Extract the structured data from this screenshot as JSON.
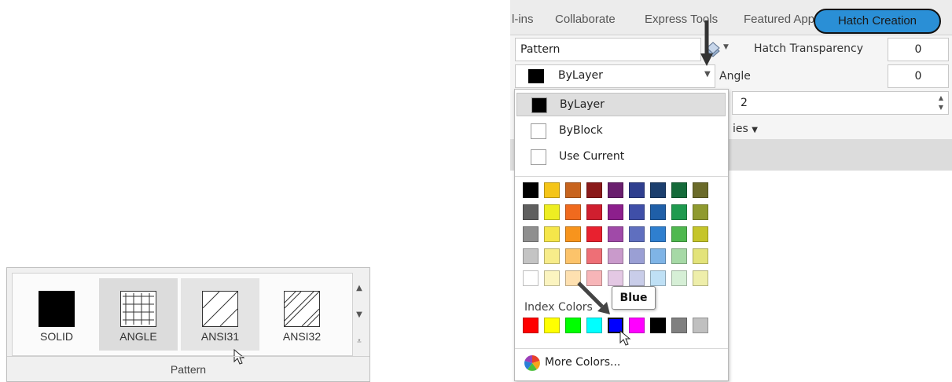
{
  "pattern_gallery": {
    "items": [
      {
        "label": "SOLID"
      },
      {
        "label": "ANGLE"
      },
      {
        "label": "ANSI31"
      },
      {
        "label": "ANSI32"
      }
    ],
    "footer_label": "Pattern"
  },
  "ribbon": {
    "tabs": [
      "l-ins",
      "Collaborate",
      "Express Tools",
      "Featured Apps"
    ],
    "active_tab": "Hatch Creation",
    "pattern_field": "Pattern",
    "color_field": "ByLayer",
    "hatch_transparency_label": "Hatch Transparency",
    "hatch_transparency_value": "0",
    "angle_label": "Angle",
    "angle_value": "0",
    "scale_value": "2",
    "properties_partial": "ies",
    "accent_color": "#2a8fd6"
  },
  "dropdown": {
    "options": [
      {
        "label": "ByLayer",
        "swatch": "#000000"
      },
      {
        "label": "ByBlock",
        "swatch": "#ffffff"
      },
      {
        "label": "Use Current",
        "swatch": "#ffffff"
      }
    ],
    "grid_colors": [
      [
        "#000000",
        "#f5c518",
        "#c8641e",
        "#8b1a1a",
        "#6a1f6e",
        "#2f3f8f",
        "#1c3f6e",
        "#156b3a",
        "#6b6b2a"
      ],
      [
        "#5f5f5f",
        "#eeee22",
        "#f06a1e",
        "#d01f2f",
        "#8c1f8c",
        "#3f4fa8",
        "#1f5fa8",
        "#1f9a4f",
        "#8f9a2f"
      ],
      [
        "#8f8f8f",
        "#f5e64a",
        "#f7941d",
        "#e8212f",
        "#a04aa8",
        "#5f6fbf",
        "#2f7fcf",
        "#4fb84f",
        "#c5c52a"
      ],
      [
        "#c4c4c4",
        "#f7ec8a",
        "#fcc36a",
        "#ee6f76",
        "#c99acb",
        "#9a9fd4",
        "#7fb4e6",
        "#a6d9a6",
        "#e3e37a"
      ],
      [
        "#ffffff",
        "#fbf4c0",
        "#fee0b0",
        "#f7b5b8",
        "#e4c8e4",
        "#c9cde9",
        "#bfe0f5",
        "#d6efd6",
        "#eeeeaa"
      ]
    ],
    "index_colors_label": "Index Colors",
    "index_colors": [
      "#ff0000",
      "#ffff00",
      "#00ff00",
      "#00ffff",
      "#0000ff",
      "#ff00ff",
      "#000000",
      "#808080",
      "#c0c0c0"
    ],
    "more_colors_label": "More Colors...",
    "tooltip": "Blue"
  }
}
